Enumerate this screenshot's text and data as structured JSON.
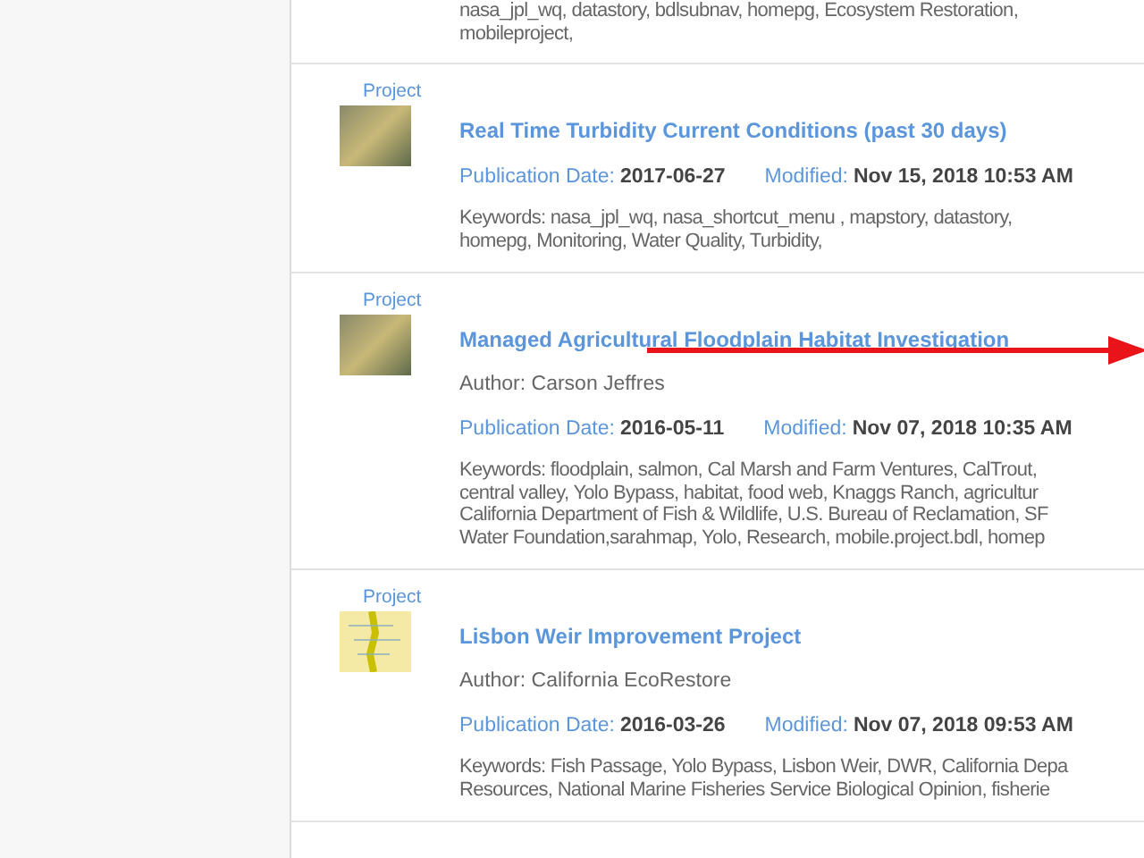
{
  "top_item": {
    "keyword_lines": [
      "nasa_jpl_wq, datastory, bdlsubnav, homepg, Ecosystem Restoration,",
      "mobileproject,"
    ]
  },
  "items": [
    {
      "type": "Project",
      "kind": "photo",
      "title": "Real Time Turbidity Current Conditions (past 30 days)",
      "publication_label": "Publication Date:",
      "publication_date": "2017-06-27",
      "modified_label": "Modified:",
      "modified": "Nov 15, 2018 10:53 AM",
      "keyword_lines": [
        "Keywords: nasa_jpl_wq, nasa_shortcut_menu , mapstory, datastory,",
        "homepg, Monitoring, Water Quality, Turbidity,"
      ]
    },
    {
      "type": "Project",
      "kind": "photo",
      "title": "Managed Agricultural Floodplain Habitat Investigation",
      "author": "Author: Carson Jeffres",
      "publication_label": "Publication Date:",
      "publication_date": "2016-05-11",
      "modified_label": "Modified:",
      "modified": "Nov 07, 2018 10:35 AM",
      "keyword_lines": [
        "Keywords: floodplain, salmon, Cal Marsh and Farm Ventures, CalTrout,",
        "central valley, Yolo Bypass, habitat, food web, Knaggs Ranch, agricultur",
        "California Department of Fish & Wildlife, U.S. Bureau of Reclamation, SF",
        "Water Foundation,sarahmap, Yolo, Research, mobile.project.bdl, homep"
      ]
    },
    {
      "type": "Project",
      "kind": "map",
      "title": "Lisbon Weir Improvement Project",
      "author": "Author: California EcoRestore",
      "publication_label": "Publication Date:",
      "publication_date": "2016-03-26",
      "modified_label": "Modified:",
      "modified": "Nov 07, 2018 09:53 AM",
      "keyword_lines": [
        "Keywords: Fish Passage, Yolo Bypass, Lisbon Weir, DWR, California Depa",
        "Resources, National Marine Fisheries Service Biological Opinion, fisherie"
      ]
    }
  ]
}
